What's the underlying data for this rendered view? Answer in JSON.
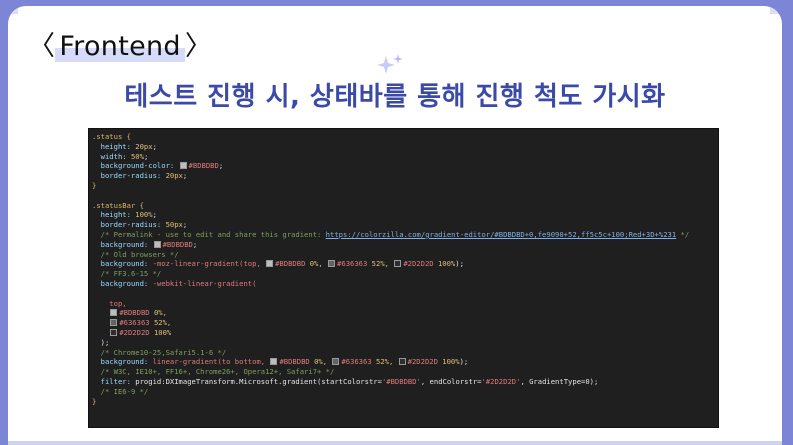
{
  "heading": {
    "open": "〈",
    "label": "Frontend",
    "close": "〉"
  },
  "title": "테스트 진행 시, 상태바를 통해 진행 척도 가시화",
  "colors": {
    "background": "#7d86d6",
    "title": "#3b4aa8",
    "highlight": "#d6dbfa"
  },
  "code_lines": [
    [
      {
        "t": ".status {",
        "c": "sel"
      }
    ],
    [
      {
        "t": "  height: ",
        "c": "prop"
      },
      {
        "t": "20px",
        "c": "num"
      },
      {
        "t": ";",
        "c": ""
      }
    ],
    [
      {
        "t": "  width: ",
        "c": "prop"
      },
      {
        "t": "50%",
        "c": "num"
      },
      {
        "t": ";",
        "c": ""
      }
    ],
    [
      {
        "t": "  background-color: ",
        "c": "prop"
      },
      {
        "sw": "#BDBDBD"
      },
      {
        "t": "#BDBDBD",
        "c": "str"
      },
      {
        "t": ";",
        "c": ""
      }
    ],
    [
      {
        "t": "  border-radius: ",
        "c": "prop"
      },
      {
        "t": "20px",
        "c": "num"
      },
      {
        "t": ";",
        "c": ""
      }
    ],
    [
      {
        "t": "}",
        "c": "brace"
      }
    ],
    [],
    [
      {
        "t": ".statusBar {",
        "c": "sel"
      }
    ],
    [
      {
        "t": "  height: ",
        "c": "prop"
      },
      {
        "t": "100%",
        "c": "num"
      },
      {
        "t": ";",
        "c": ""
      }
    ],
    [
      {
        "t": "  border-radius: ",
        "c": "prop"
      },
      {
        "t": "50px",
        "c": "num"
      },
      {
        "t": ";",
        "c": ""
      }
    ],
    [
      {
        "t": "  /* Permalink - use to edit and share this gradient: ",
        "c": "cmt"
      },
      {
        "t": "https://colorzilla.com/gradient-editor/#BDBDBD+0,fe9090+52,ff5c5c+100;Red+3D+%231",
        "c": "link"
      },
      {
        "t": " */",
        "c": "cmt"
      }
    ],
    [
      {
        "t": "  background: ",
        "c": "prop"
      },
      {
        "sw": "#BDBDBD"
      },
      {
        "t": "#BDBDBD",
        "c": "str"
      },
      {
        "t": ";",
        "c": ""
      }
    ],
    [
      {
        "t": "  /* Old browsers */",
        "c": "cmt"
      }
    ],
    [
      {
        "t": "  background: ",
        "c": "prop"
      },
      {
        "t": "-moz-linear-gradient(top, ",
        "c": "str"
      },
      {
        "sw": "#BDBDBD"
      },
      {
        "t": "#BDBDBD ",
        "c": "str"
      },
      {
        "t": "0%, ",
        "c": "num"
      },
      {
        "sw": "#636363"
      },
      {
        "t": "#636363 ",
        "c": "str"
      },
      {
        "t": "52%, ",
        "c": "num"
      },
      {
        "sw": "#2D2D2D"
      },
      {
        "t": "#2D2D2D ",
        "c": "str"
      },
      {
        "t": "100%",
        "c": "num"
      },
      {
        "t": ");",
        "c": ""
      }
    ],
    [
      {
        "t": "  /* FF3.6-15 */",
        "c": "cmt"
      }
    ],
    [
      {
        "t": "  background: ",
        "c": "prop"
      },
      {
        "t": "-webkit-linear-gradient(",
        "c": "str"
      }
    ],
    [],
    [
      {
        "t": "    top,",
        "c": "str"
      }
    ],
    [
      {
        "t": "    ",
        "c": ""
      },
      {
        "sw": "#BDBDBD"
      },
      {
        "t": "#BDBDBD ",
        "c": "str"
      },
      {
        "t": "0%,",
        "c": "num"
      }
    ],
    [
      {
        "t": "    ",
        "c": ""
      },
      {
        "sw": "#636363"
      },
      {
        "t": "#636363 ",
        "c": "str"
      },
      {
        "t": "52%,",
        "c": "num"
      }
    ],
    [
      {
        "t": "    ",
        "c": ""
      },
      {
        "sw": "#2D2D2D"
      },
      {
        "t": "#2D2D2D ",
        "c": "str"
      },
      {
        "t": "100%",
        "c": "num"
      }
    ],
    [
      {
        "t": "  );",
        "c": ""
      }
    ],
    [
      {
        "t": "  /* Chrome10-25,Safari5.1-6 */",
        "c": "cmt"
      }
    ],
    [
      {
        "t": "  background: ",
        "c": "prop"
      },
      {
        "t": "linear-gradient(to bottom, ",
        "c": "str"
      },
      {
        "sw": "#BDBDBD"
      },
      {
        "t": "#BDBDBD ",
        "c": "str"
      },
      {
        "t": "0%, ",
        "c": "num"
      },
      {
        "sw": "#636363"
      },
      {
        "t": "#636363 ",
        "c": "str"
      },
      {
        "t": "52%, ",
        "c": "num"
      },
      {
        "sw": "#2D2D2D"
      },
      {
        "t": "#2D2D2D ",
        "c": "str"
      },
      {
        "t": "100%",
        "c": "num"
      },
      {
        "t": ");",
        "c": ""
      }
    ],
    [
      {
        "t": "  /* W3C, IE10+, FF16+, Chrome26+, Opera12+, Safari7+ */",
        "c": "cmt"
      }
    ],
    [
      {
        "t": "  filter: ",
        "c": "prop"
      },
      {
        "t": "progid:DXImageTransform.Microsoft.gradient(startColorstr=",
        "c": ""
      },
      {
        "t": "'#BDBDBD'",
        "c": "str"
      },
      {
        "t": ", endColorstr=",
        "c": ""
      },
      {
        "t": "'#2D2D2D'",
        "c": "str"
      },
      {
        "t": ", GradientType=0);",
        "c": ""
      }
    ],
    [
      {
        "t": "  /* IE6-9 */",
        "c": "cmt"
      }
    ],
    [
      {
        "t": "}",
        "c": "brace"
      }
    ]
  ]
}
